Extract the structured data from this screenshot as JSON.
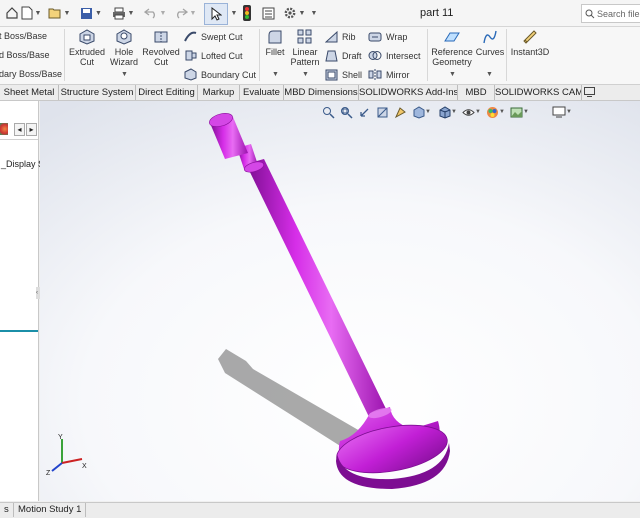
{
  "document": {
    "title": "part 11"
  },
  "search": {
    "placeholder": "Search file"
  },
  "features": {
    "boss_base": [
      "Extruded Boss/Base",
      "Revolved Boss/Base",
      "Boundary Boss/Base"
    ],
    "boss_base_visible": [
      "pt Boss/Base",
      "ed Boss/Base",
      "ndary Boss/Base"
    ],
    "extruded_cut": [
      "Extruded",
      "Cut"
    ],
    "hole_wizard": [
      "Hole",
      "Wizard"
    ],
    "revolved_cut": [
      "Revolved",
      "Cut"
    ],
    "swept_cut": "Swept Cut",
    "lofted_cut": "Lofted Cut",
    "boundary_cut": "Boundary Cut",
    "fillet": "Fillet",
    "linear_pattern": [
      "Linear",
      "Pattern"
    ],
    "rib": "Rib",
    "draft": "Draft",
    "shell": "Shell",
    "wrap": "Wrap",
    "intersect": "Intersect",
    "mirror": "Mirror",
    "reference_geometry": [
      "Reference",
      "Geometry"
    ],
    "curves": "Curves",
    "instant3d": "Instant3D"
  },
  "tabs": [
    "Sheet Metal",
    "Structure System",
    "Direct Editing",
    "Markup",
    "Evaluate",
    "MBD Dimensions",
    "SOLIDWORKS Add-Ins",
    "MBD",
    "SOLIDWORKS CAM"
  ],
  "feature_tree": {
    "item_partial": "_Display S"
  },
  "bottom_tabs": [
    "s",
    "Motion Study 1"
  ],
  "triad": {
    "x": "X",
    "y": "Y",
    "z": "Z"
  },
  "colors": {
    "part": "#c21fd6",
    "part_dark": "#8f0fa3",
    "part_light": "#e57cf0",
    "accent_blue": "#1e6fd0"
  }
}
